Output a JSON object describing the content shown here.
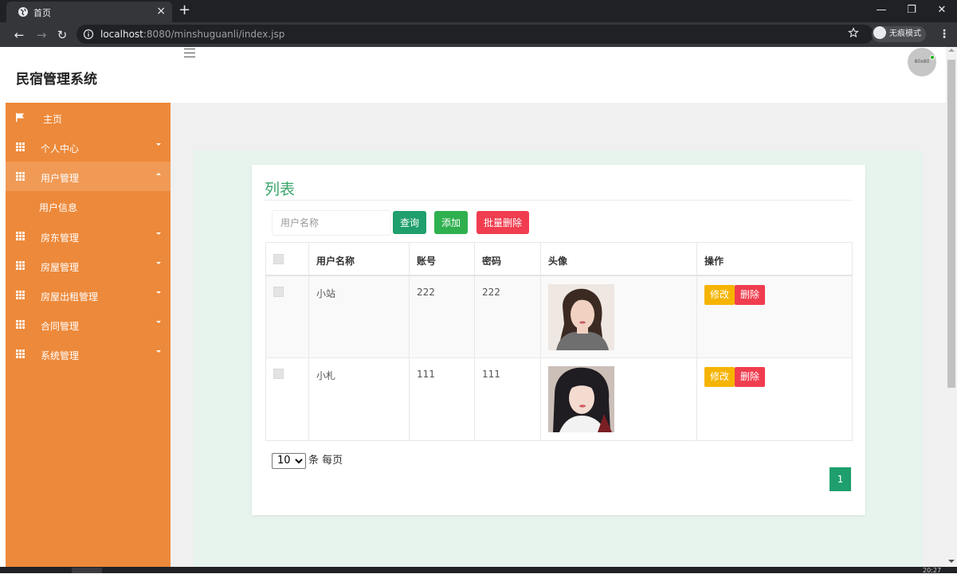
{
  "browser": {
    "tab_title": "首页",
    "tab_close": "×",
    "new_tab": "+",
    "url_host": "localhost",
    "url_rest": ":8080/minshuguanli/index.jsp",
    "incognito_label": "无痕模式",
    "window_controls": [
      "—",
      "❐",
      "✕"
    ]
  },
  "app": {
    "title": "民宿管理系统",
    "avatar_text": "80x80",
    "accent_color": "#ed893a",
    "brand_green": "#1e9f6c"
  },
  "sidebar": {
    "items": [
      {
        "label": "主页",
        "icon": "flag-icon"
      },
      {
        "label": "个人中心",
        "icon": "grid-icon",
        "arrow": "down"
      },
      {
        "label": "用户管理",
        "icon": "grid-icon",
        "arrow": "up",
        "active": true
      },
      {
        "label": "房东管理",
        "icon": "grid-icon",
        "arrow": "down"
      },
      {
        "label": "房屋管理",
        "icon": "grid-icon",
        "arrow": "down"
      },
      {
        "label": "房屋出租管理",
        "icon": "grid-icon",
        "arrow": "down"
      },
      {
        "label": "合同管理",
        "icon": "grid-icon",
        "arrow": "down"
      },
      {
        "label": "系统管理",
        "icon": "grid-icon",
        "arrow": "down"
      }
    ],
    "sub_item": "用户信息"
  },
  "list": {
    "title": "列表",
    "search_placeholder": "用户名称",
    "btn_query": "查询",
    "btn_add": "添加",
    "btn_batch_delete": "批量删除",
    "columns": [
      "用户名称",
      "账号",
      "密码",
      "头像",
      "操作"
    ],
    "rows": [
      {
        "name": "小站",
        "account": "222",
        "password": "222",
        "edit": "修改",
        "delete": "删除"
      },
      {
        "name": "小札",
        "account": "111",
        "password": "111",
        "edit": "修改",
        "delete": "删除"
      }
    ],
    "page_size": "10",
    "page_size_suffix": "条 每页",
    "current_page": "1"
  },
  "system": {
    "clock": "20:27"
  }
}
